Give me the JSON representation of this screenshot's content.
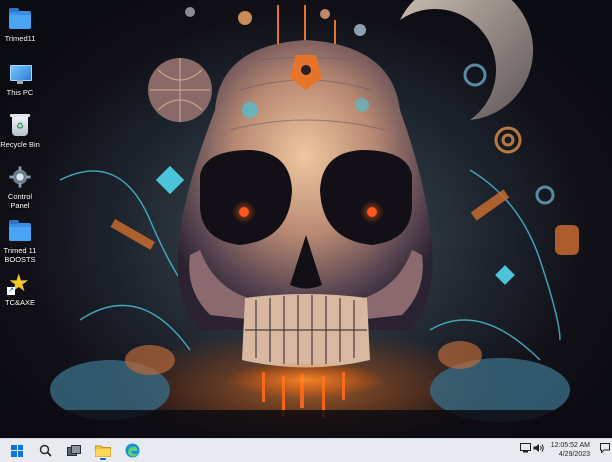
{
  "desktop": {
    "icons": [
      {
        "label": "Trimed11",
        "icon": "folder-icon"
      },
      {
        "label": "This PC",
        "icon": "monitor-icon"
      },
      {
        "label": "Recycle Bin",
        "icon": "recycle-bin-icon"
      },
      {
        "label": "Control Panel",
        "icon": "control-panel-icon"
      },
      {
        "label": "Trimed 11 BOOSTS",
        "icon": "folder-icon"
      },
      {
        "label": "TC&AXE",
        "icon": "star-shortcut-icon"
      }
    ]
  },
  "taskbar": {
    "buttons": [
      {
        "name": "start",
        "icon": "windows-logo-icon"
      },
      {
        "name": "search",
        "icon": "search-icon"
      },
      {
        "name": "task-view",
        "icon": "task-view-icon"
      },
      {
        "name": "file-explorer",
        "icon": "folder-icon"
      },
      {
        "name": "edge",
        "icon": "edge-browser-icon"
      }
    ],
    "tray": {
      "network_icon": "network-icon",
      "volume_icon": "speaker-icon",
      "time": "12:05:52 AM",
      "date": "4/29/2023",
      "notification_icon": "notification-icon"
    }
  },
  "colors": {
    "accent": "#0a74da",
    "taskbar_bg": "#e7ebf0",
    "wallpaper_orange": "#e8742a",
    "wallpaper_teal": "#4cc3d9"
  }
}
